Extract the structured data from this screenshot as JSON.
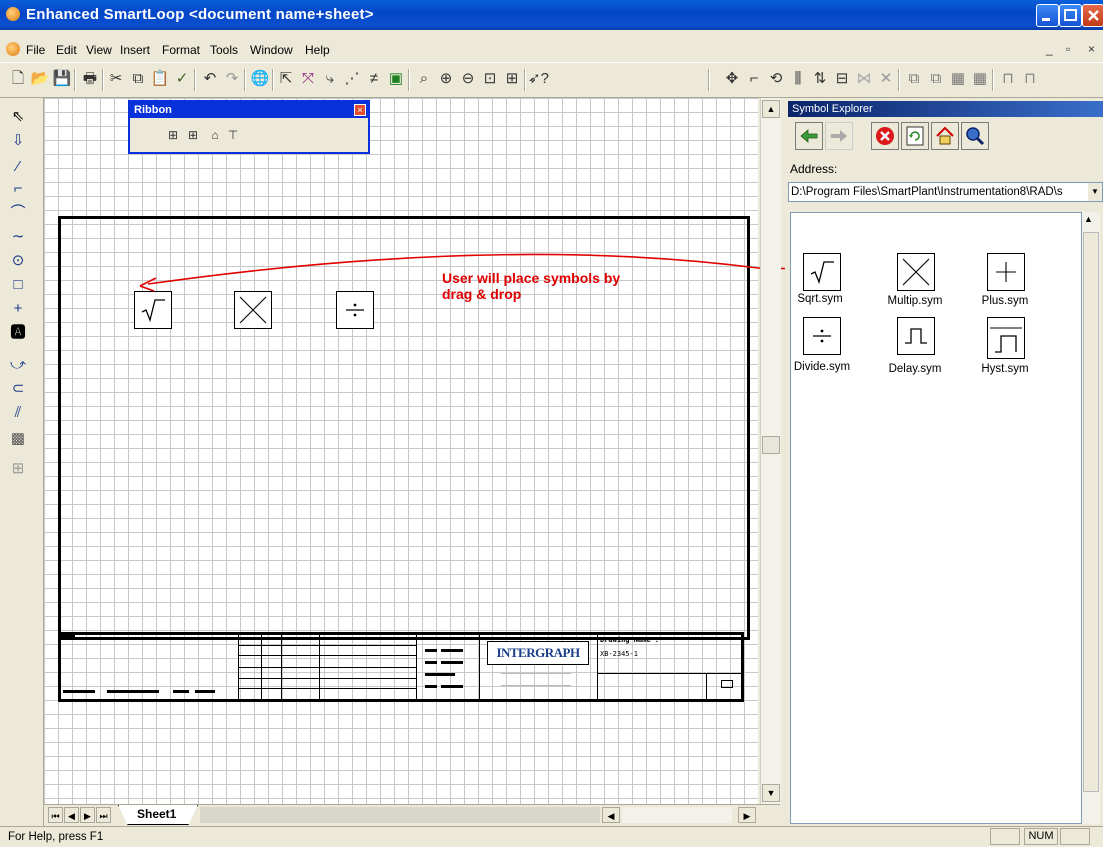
{
  "window": {
    "title": "Enhanced SmartLoop <document name+sheet>"
  },
  "menu": {
    "items": [
      "File",
      "Edit",
      "View",
      "Insert",
      "Format",
      "Tools",
      "Window",
      "Help"
    ]
  },
  "ribbon": {
    "title": "Ribbon"
  },
  "annotation": {
    "line1": "User will place symbols by",
    "line2": "drag & drop"
  },
  "titleblock": {
    "logo": "INTERGRAPH",
    "drawing_name_label": "Drawing Name :",
    "drawing_number": "XB-2345-1"
  },
  "sheet_tab": {
    "label": "Sheet1"
  },
  "explorer": {
    "title": "Symbol Explorer",
    "address_label": "Address:",
    "address_value": "D:\\Program Files\\SmartPlant\\Instrumentation8\\RAD\\s",
    "symbols": [
      "Sqrt.sym",
      "Multip.sym",
      "Plus.sym",
      "Divide.sym",
      "Delay.sym",
      "Hyst.sym"
    ]
  },
  "status": {
    "help_text": "For Help, press F1",
    "num": "NUM"
  },
  "colors": {
    "annotation": "#e00000",
    "title_bar": "#0347c8",
    "explorer_title": "#0a246a"
  }
}
